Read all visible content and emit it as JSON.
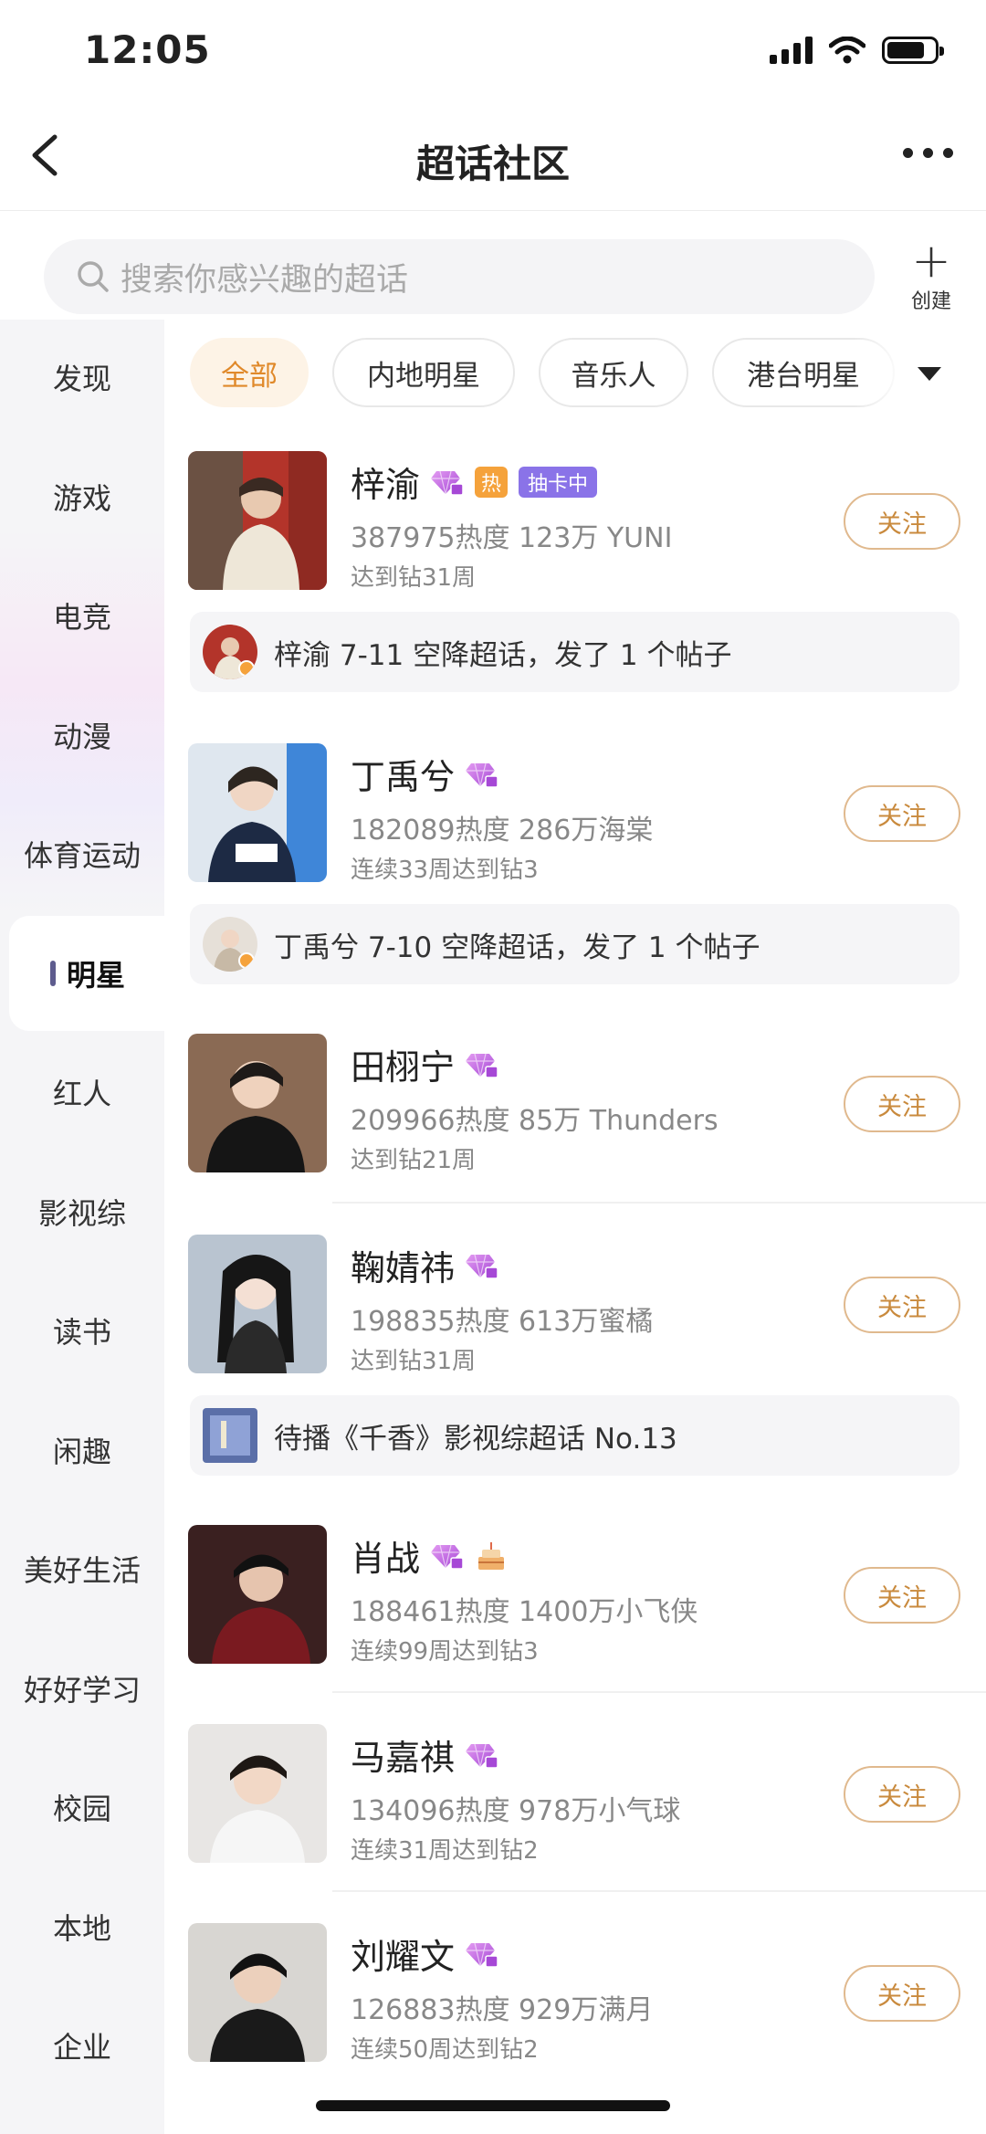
{
  "status_bar": {
    "time": "12:05"
  },
  "nav": {
    "title": "超话社区"
  },
  "search": {
    "placeholder": "搜索你感兴趣的超话"
  },
  "create": {
    "label": "创建"
  },
  "sidebar": {
    "items": [
      "发现",
      "游戏",
      "电竞",
      "动漫",
      "体育运动",
      "明星",
      "红人",
      "影视综",
      "读书",
      "闲趣",
      "美好生活",
      "好好学习",
      "校园",
      "本地",
      "企业"
    ],
    "active": "明星"
  },
  "chips": [
    "全部",
    "内地明星",
    "音乐人",
    "港台明星"
  ],
  "badges": {
    "hot": "热",
    "card": "抽卡中"
  },
  "follow_label": "关注",
  "list": [
    {
      "name": "梓渝",
      "meta": "387975热度 123万 YUNI",
      "sub": "达到钻31周",
      "notice": "梓渝 7-11 空降超话，发了 1 个帖子"
    },
    {
      "name": "丁禹兮",
      "meta": "182089热度 286万海棠",
      "sub": "连续33周达到钻3",
      "notice": "丁禹兮 7-10 空降超话，发了 1 个帖子"
    },
    {
      "name": "田栩宁",
      "meta": "209966热度 85万 Thunders",
      "sub": "达到钻21周"
    },
    {
      "name": "鞠婧祎",
      "meta": "198835热度 613万蜜橘",
      "sub": "达到钻31周",
      "notice": "待播《千香》影视综超话 No.13"
    },
    {
      "name": "肖战",
      "meta": "188461热度 1400万小飞侠",
      "sub": "连续99周达到钻3"
    },
    {
      "name": "马嘉祺",
      "meta": "134096热度 978万小气球",
      "sub": "连续31周达到钻2"
    },
    {
      "name": "刘耀文",
      "meta": "126883热度 929万满月",
      "sub": "连续50周达到钻2"
    }
  ],
  "colors": {
    "accent": "#e0892a",
    "follow": "#c98a3d",
    "gem": "#c060d8",
    "hot": "#f5a23b",
    "card": "#8a73e8"
  }
}
